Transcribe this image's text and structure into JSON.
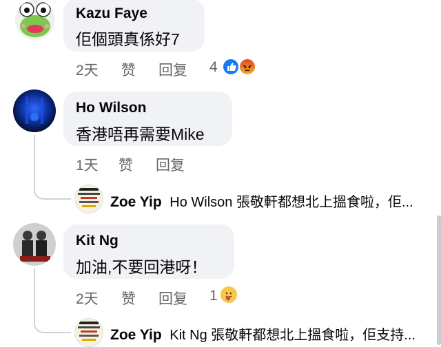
{
  "comments": [
    {
      "author": "Kazu Faye",
      "text": "佢個頭真係好7",
      "time": "2天",
      "like_label": "赞",
      "reply_label": "回复",
      "reaction_count": "4",
      "reactions": [
        "like-icon",
        "angry-icon"
      ]
    },
    {
      "author": "Ho Wilson",
      "text": "香港唔再需要Mike",
      "time": "1天",
      "like_label": "赞",
      "reply_label": "回复",
      "reply": {
        "author": "Zoe Yip",
        "text": "Ho Wilson 張敬軒都想北上搵食啦，佢..."
      }
    },
    {
      "author": "Kit Ng",
      "text": "加油,不要回港呀！",
      "time": "2天",
      "like_label": "赞",
      "reply_label": "回复",
      "reaction_count": "1",
      "reactions": [
        "care-icon"
      ],
      "reply": {
        "author": "Zoe Yip",
        "text": "Kit Ng 張敬軒都想北上搵食啦，佢支持..."
      }
    }
  ],
  "colors": {
    "bubble": "#f0f2f5",
    "secondary_text": "#65676b",
    "like_blue": "#1877f2"
  }
}
